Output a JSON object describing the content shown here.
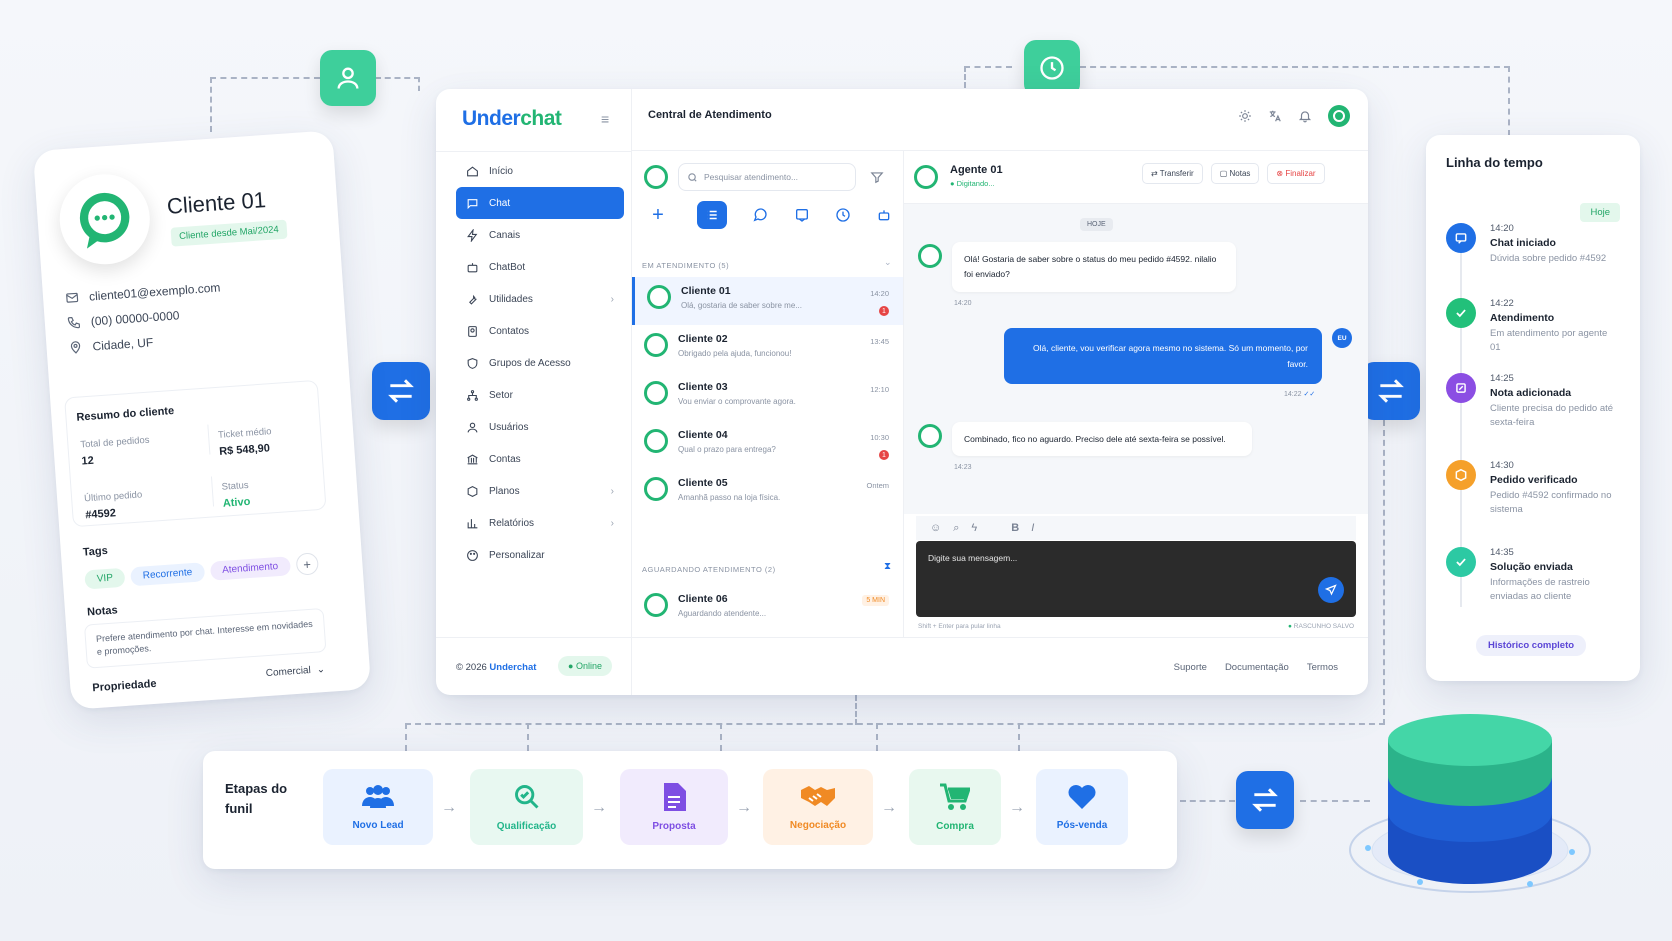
{
  "client_card": {
    "name": "Cliente 01",
    "since": "Cliente desde Mai/2024",
    "email": "cliente01@exemplo.com",
    "phone": "(00) 00000-0000",
    "city": "Cidade, UF",
    "summary_title": "Resumo do cliente",
    "total_orders_label": "Total de pedidos",
    "total_orders_value": "12",
    "avg_ticket_label": "Ticket médio",
    "avg_ticket_value": "R$ 548,90",
    "last_order_label": "Último pedido",
    "last_order_value": "#4592",
    "status_label": "Status",
    "status_value": "Ativo",
    "tags_title": "Tags",
    "tags": [
      "VIP",
      "Recorrente",
      "Atendimento"
    ],
    "add_tag": "+",
    "notes_title": "Notas",
    "notes_text": "Prefere atendimento por chat. Interesse em novidades e promoções.",
    "owner_label": "Propriedade",
    "owner_value": "Comercial"
  },
  "app": {
    "brand_main": "Under",
    "brand_accent": "chat",
    "header_title": "Central de Atendimento",
    "nav": [
      "Início",
      "Chat",
      "Canais",
      "ChatBot",
      "Utilidades",
      "Contatos",
      "Grupos de Acesso",
      "Setor",
      "Usuários",
      "Contas",
      "Planos",
      "Relatórios",
      "Personalizar"
    ],
    "search_placeholder": "Pesquisar atendimento...",
    "section_active": "EM ATENDIMENTO (5)",
    "section_waiting": "AGUARDANDO ATENDIMENTO (2)",
    "conversations": [
      {
        "name": "Cliente 01",
        "msg": "Olá, gostaria de saber sobre me...",
        "time": "14:20",
        "badge": "1"
      },
      {
        "name": "Cliente 02",
        "msg": "Obrigado pela ajuda, funcionou!",
        "time": "13:45",
        "badge": ""
      },
      {
        "name": "Cliente 03",
        "msg": "Vou enviar o comprovante agora.",
        "time": "12:10",
        "badge": ""
      },
      {
        "name": "Cliente 04",
        "msg": "Qual o prazo para entrega?",
        "time": "10:30",
        "badge": "1"
      },
      {
        "name": "Cliente 05",
        "msg": "Amanhã passo na loja física.",
        "time": "Ontem",
        "badge": ""
      }
    ],
    "waiting": [
      {
        "name": "Cliente 06",
        "msg": "Aguardando atendente...",
        "time": "5 MIN"
      }
    ],
    "agent_name": "Agente 01",
    "agent_status": "Digitando...",
    "btn_transfer": "Transferir",
    "btn_notes": "Notas",
    "btn_finish": "Finalizar",
    "day_chip": "HOJE",
    "messages": [
      {
        "text": "Olá! Gostaria de saber sobre o status do meu pedido #4592. nilalio foi enviado?",
        "time": "14:20"
      },
      {
        "text": "Olá, cliente, vou verificar agora mesmo no sistema. Só um momento, por favor.",
        "time": "14:22",
        "avatar": "EU"
      },
      {
        "text": "Combinado, fico no aguardo. Preciso dele até sexta-feira se possível.",
        "time": "14:23"
      }
    ],
    "composer_placeholder": "Digite sua mensagem...",
    "composer_hint": "Shift + Enter para pular linha",
    "draft_status": "RASCUNHO SALVO",
    "footer_copy": "© 2026 ",
    "footer_brand": "Underchat",
    "footer_online": "Online",
    "footer_links": [
      "Suporte",
      "Documentação",
      "Termos"
    ]
  },
  "timeline": {
    "title": "Linha do tempo",
    "today": "Hoje",
    "items": [
      {
        "time": "14:20",
        "title": "Chat iniciado",
        "desc": "Dúvida sobre pedido #4592",
        "color": "#1f6fe5"
      },
      {
        "time": "14:22",
        "title": "Atendimento",
        "desc": "Em atendimento por agente 01",
        "color": "#22c07a"
      },
      {
        "time": "14:25",
        "title": "Nota adicionada",
        "desc": "Cliente precisa do pedido até sexta-feira",
        "color": "#8b4ee3"
      },
      {
        "time": "14:30",
        "title": "Pedido verificado",
        "desc": "Pedido #4592 confirmado no sistema",
        "color": "#f5a02a"
      },
      {
        "time": "14:35",
        "title": "Solução enviada",
        "desc": "Informações de rastreio enviadas ao cliente",
        "color": "#2cc9a3"
      }
    ],
    "full_history": "Histórico completo"
  },
  "funnel": {
    "title": "Etapas do funil",
    "stages": [
      {
        "label": "Novo Lead",
        "color": "#1f6fe5",
        "bg": "#eaf2ff"
      },
      {
        "label": "Qualificação",
        "color": "#22b58a",
        "bg": "#e8f8f1"
      },
      {
        "label": "Proposta",
        "color": "#7e4ee3",
        "bg": "#f1ebfd"
      },
      {
        "label": "Negociação",
        "color": "#f08a24",
        "bg": "#fff1e4"
      },
      {
        "label": "Compra",
        "color": "#22b573",
        "bg": "#e8f8ef"
      },
      {
        "label": "Pós-venda",
        "color": "#1f6fe5",
        "bg": "#eaf2ff"
      }
    ]
  }
}
